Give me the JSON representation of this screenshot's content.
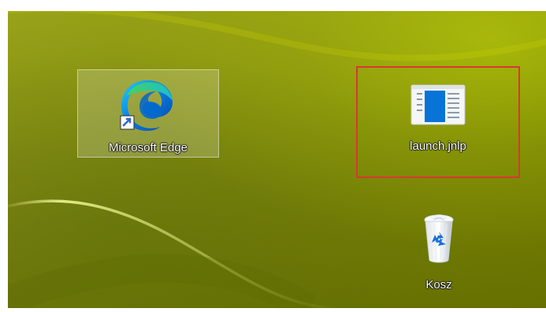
{
  "desktop": {
    "icons": [
      {
        "label": "Microsoft Edge",
        "icon": "microsoft-edge-icon",
        "selected": true,
        "shortcut": true
      },
      {
        "label": "launch.jnlp",
        "icon": "jnlp-file-icon",
        "highlighted": true
      },
      {
        "label": "Kosz",
        "icon": "recycle-bin-icon"
      }
    ]
  },
  "colors": {
    "wallpaper_dark": "#6c7700",
    "wallpaper_mid": "#8d9800",
    "wallpaper_light": "#c3d000",
    "highlight_red": "#d63a2f",
    "selection_fill": "#ffffff33",
    "label_text": "#ffffff"
  }
}
